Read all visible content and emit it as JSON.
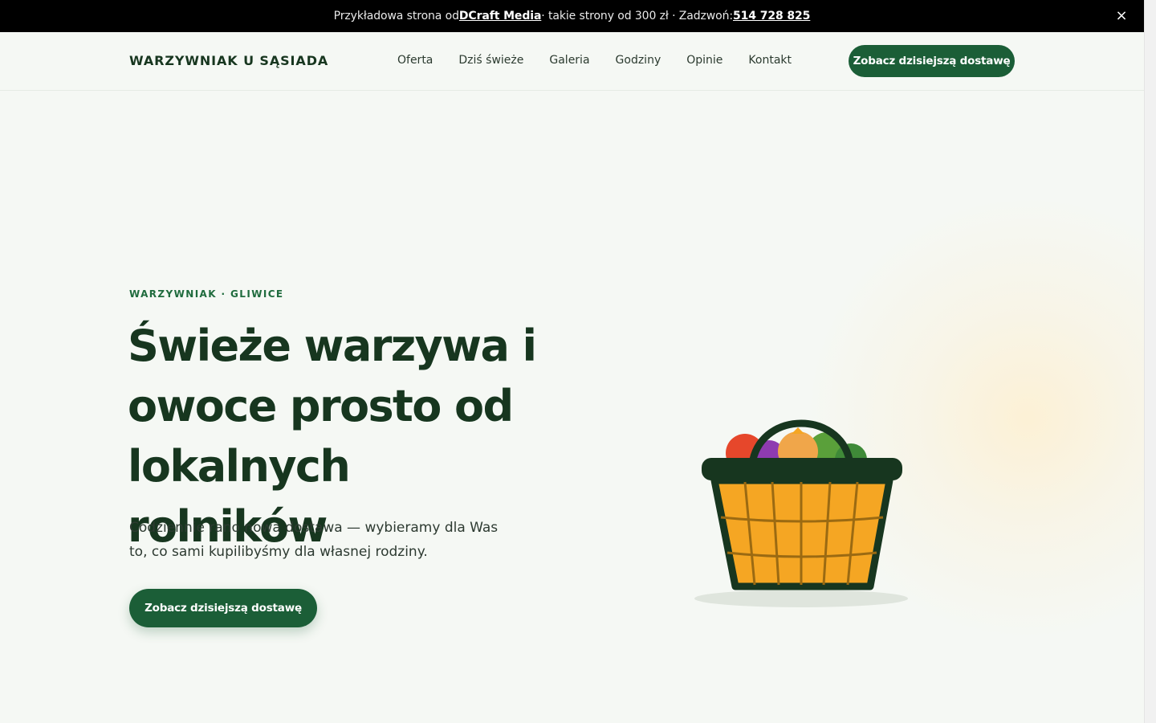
{
  "announcement": {
    "prefix": "Przykładowa strona od ",
    "link_label": "DCraft Media",
    "middle": " · takie strony od 300 zł · Zadzwoń: ",
    "phone": "514 728 825",
    "close_symbol": "×"
  },
  "header": {
    "brand": "WARZYWNIAK U SĄSIADA",
    "nav": [
      "Oferta",
      "Dziś świeże",
      "Galeria",
      "Godziny",
      "Opinie",
      "Kontakt"
    ],
    "cta_label": "Zobacz dzisiejszą dostawę"
  },
  "hero": {
    "eyebrow": "WARZYWNIAK · GLIWICE",
    "headline": "Świeże warzywa i owoce prosto od lokalnych rolników",
    "lead": "Codziennie rano nowa dostawa — wybieramy dla Was to, co sami kupilibyśmy dla własnej rodziny.",
    "cta_label": "Zobacz dzisiejszą dostawę"
  },
  "colors": {
    "accent": "#1b5e37",
    "dark_text": "#17361f",
    "background": "#f5f8f4",
    "basket_orange": "#f5a623",
    "basket_frame": "#17361f"
  },
  "icons": {
    "close": "close-icon",
    "basket": "vegetable-basket-illustration"
  }
}
